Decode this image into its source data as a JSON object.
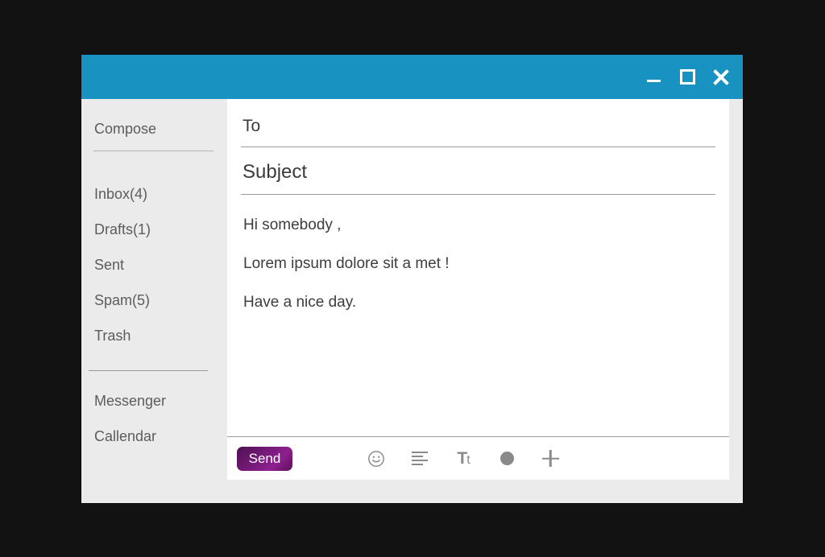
{
  "window": {
    "titlebar": {
      "color": "#1892c0",
      "controls": [
        {
          "name": "minimize",
          "label": "Minimize"
        },
        {
          "name": "maximize",
          "label": "Maximize"
        },
        {
          "name": "close",
          "label": "Close"
        }
      ]
    }
  },
  "sidebar": {
    "background": "#ebebeb",
    "compose": "Compose",
    "nav": [
      {
        "label": "Inbox(4)"
      },
      {
        "label": "Drafts(1)"
      },
      {
        "label": "Sent"
      },
      {
        "label": "Spam(5)"
      },
      {
        "label": "Trash"
      }
    ],
    "apps": [
      {
        "label": "Messenger"
      },
      {
        "label": "Callendar"
      }
    ]
  },
  "compose": {
    "to": {
      "value": "",
      "placeholder": "To"
    },
    "subject": {
      "value": "",
      "placeholder": "Subject"
    },
    "body": [
      "Hi somebody ,",
      "Lorem ipsum dolore sit a met !",
      "Have a nice day."
    ]
  },
  "toolbar": {
    "send_label": "Send",
    "send_color": "#7b1b7e",
    "icon_color": "#8a8a8a",
    "icons": [
      {
        "name": "emoji-icon",
        "glyph": "emoji"
      },
      {
        "name": "align-left-icon",
        "glyph": "align"
      },
      {
        "name": "text-format-icon",
        "glyph": "Tt"
      },
      {
        "name": "color-dot-icon",
        "glyph": "circle"
      },
      {
        "name": "attach-more-icon",
        "glyph": "plus"
      }
    ]
  }
}
